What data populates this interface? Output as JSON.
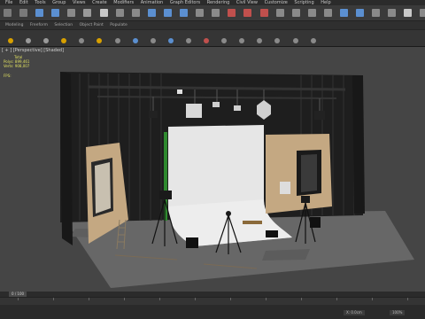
{
  "menu": [
    "File",
    "Edit",
    "Tools",
    "Group",
    "Views",
    "Create",
    "Modifiers",
    "Animation",
    "Graph Editors",
    "Rendering",
    "Civil View",
    "Customize",
    "Scripting",
    "Help"
  ],
  "ribbon_tabs": [
    "Modeling",
    "Freeform",
    "Selection",
    "Object Paint",
    "Populate"
  ],
  "viewport": {
    "label": "[ + ] [Perspective] [Shaded]"
  },
  "stats": {
    "header": "Total",
    "polys_label": "Polys:",
    "polys_value": "899,461",
    "verts_label": "Verts:",
    "verts_value": "908,007",
    "fps_label": "FPS:"
  },
  "timeslider": {
    "label": "0 / 100"
  },
  "statusbar": {
    "coord": "X: 0.0cm",
    "zoom": "100%"
  },
  "colors": {
    "bg": "#262626",
    "viewport": "#454545",
    "stats": "#e0e060"
  }
}
